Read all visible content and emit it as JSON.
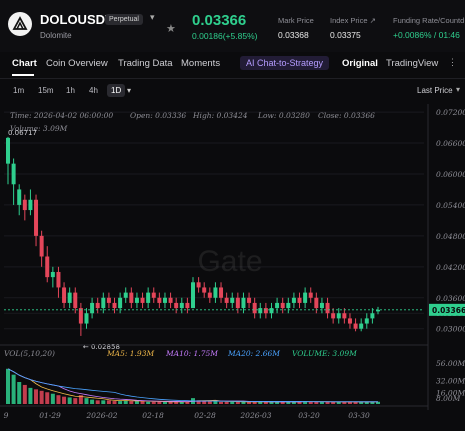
{
  "header": {
    "symbol": "DOLOUSDT",
    "badge": "Perpetual",
    "name": "Dolomite",
    "price": "0.03366",
    "change": "0.00186(+5.85%)",
    "mark_label": "Mark Price",
    "mark_value": "0.03368",
    "index_label": "Index Price ↗",
    "index_value": "0.03375",
    "funding_label": "Funding Rate/Countd",
    "funding_value": "+0.0086% / 01:46"
  },
  "tabs": [
    "Chart",
    "Coin Overview",
    "Trading Data",
    "Moments"
  ],
  "ai_button": "AI Chat-to-Strategy",
  "view_tabs": [
    "Original",
    "TradingView"
  ],
  "timeframes": [
    "1m",
    "15m",
    "1h",
    "4h",
    "1D"
  ],
  "last_price_dropdown": "Last Price",
  "ohlc": {
    "time": "Time: 2026-04-02 06:00:00",
    "open": "Open: 0.03336",
    "high": "High: 0.03424",
    "low": "Low: 0.03280",
    "close": "Close: 0.03366",
    "volume": "Volume: 3.09M"
  },
  "watermark": "Gate",
  "chart_data": {
    "type": "candlestick",
    "y_ticks": [
      "0.07200",
      "0.06600",
      "0.06000",
      "0.05400",
      "0.04800",
      "0.04200",
      "0.03600",
      "0.03300",
      "0.03000"
    ],
    "ylim": [
      0.0282,
      0.0724
    ],
    "current_price": 0.03366,
    "current_price_label": "0.03366",
    "high_marker": "0.06717",
    "low_marker": "0.02858",
    "x_ticks": [
      "9",
      "01-29",
      "2026-02",
      "02-18",
      "02-28",
      "2026-03",
      "03-20",
      "03-30"
    ],
    "candles": [
      [
        0.062,
        0.067,
        0.058,
        0.0672
      ],
      [
        0.058,
        0.062,
        0.054,
        0.063
      ],
      [
        0.054,
        0.057,
        0.052,
        0.058
      ],
      [
        0.055,
        0.053,
        0.051,
        0.056
      ],
      [
        0.053,
        0.055,
        0.052,
        0.057
      ],
      [
        0.055,
        0.048,
        0.046,
        0.056
      ],
      [
        0.048,
        0.044,
        0.042,
        0.049
      ],
      [
        0.044,
        0.04,
        0.039,
        0.046
      ],
      [
        0.04,
        0.041,
        0.038,
        0.042
      ],
      [
        0.041,
        0.038,
        0.036,
        0.042
      ],
      [
        0.038,
        0.035,
        0.034,
        0.039
      ],
      [
        0.035,
        0.037,
        0.034,
        0.038
      ],
      [
        0.037,
        0.034,
        0.033,
        0.038
      ],
      [
        0.034,
        0.031,
        0.0286,
        0.035
      ],
      [
        0.031,
        0.033,
        0.03,
        0.034
      ],
      [
        0.033,
        0.035,
        0.032,
        0.036
      ],
      [
        0.035,
        0.034,
        0.033,
        0.036
      ],
      [
        0.034,
        0.036,
        0.033,
        0.037
      ],
      [
        0.036,
        0.035,
        0.034,
        0.037
      ],
      [
        0.035,
        0.034,
        0.033,
        0.036
      ],
      [
        0.034,
        0.036,
        0.033,
        0.037
      ],
      [
        0.036,
        0.037,
        0.035,
        0.038
      ],
      [
        0.037,
        0.035,
        0.034,
        0.038
      ],
      [
        0.035,
        0.036,
        0.034,
        0.037
      ],
      [
        0.036,
        0.035,
        0.034,
        0.037
      ],
      [
        0.035,
        0.037,
        0.034,
        0.038
      ],
      [
        0.037,
        0.036,
        0.035,
        0.038
      ],
      [
        0.036,
        0.035,
        0.034,
        0.037
      ],
      [
        0.035,
        0.036,
        0.034,
        0.037
      ],
      [
        0.036,
        0.035,
        0.034,
        0.037
      ],
      [
        0.035,
        0.034,
        0.033,
        0.036
      ],
      [
        0.034,
        0.035,
        0.033,
        0.036
      ],
      [
        0.035,
        0.034,
        0.033,
        0.036
      ],
      [
        0.034,
        0.039,
        0.034,
        0.04
      ],
      [
        0.039,
        0.038,
        0.037,
        0.04
      ],
      [
        0.038,
        0.037,
        0.036,
        0.039
      ],
      [
        0.037,
        0.036,
        0.035,
        0.038
      ],
      [
        0.036,
        0.038,
        0.035,
        0.039
      ],
      [
        0.038,
        0.036,
        0.035,
        0.039
      ],
      [
        0.036,
        0.035,
        0.034,
        0.037
      ],
      [
        0.035,
        0.036,
        0.034,
        0.037
      ],
      [
        0.036,
        0.034,
        0.033,
        0.037
      ],
      [
        0.034,
        0.036,
        0.033,
        0.037
      ],
      [
        0.036,
        0.035,
        0.034,
        0.037
      ],
      [
        0.035,
        0.033,
        0.032,
        0.036
      ],
      [
        0.033,
        0.034,
        0.032,
        0.035
      ],
      [
        0.034,
        0.033,
        0.032,
        0.035
      ],
      [
        0.033,
        0.034,
        0.032,
        0.035
      ],
      [
        0.034,
        0.035,
        0.033,
        0.036
      ],
      [
        0.035,
        0.034,
        0.033,
        0.036
      ],
      [
        0.034,
        0.035,
        0.033,
        0.036
      ],
      [
        0.035,
        0.036,
        0.034,
        0.037
      ],
      [
        0.036,
        0.035,
        0.034,
        0.037
      ],
      [
        0.035,
        0.037,
        0.034,
        0.038
      ],
      [
        0.037,
        0.036,
        0.035,
        0.038
      ],
      [
        0.036,
        0.034,
        0.033,
        0.037
      ],
      [
        0.034,
        0.035,
        0.033,
        0.036
      ],
      [
        0.035,
        0.033,
        0.032,
        0.036
      ],
      [
        0.033,
        0.032,
        0.031,
        0.034
      ],
      [
        0.032,
        0.033,
        0.031,
        0.034
      ],
      [
        0.033,
        0.032,
        0.031,
        0.034
      ],
      [
        0.032,
        0.031,
        0.03,
        0.033
      ],
      [
        0.031,
        0.03,
        0.0295,
        0.032
      ],
      [
        0.03,
        0.031,
        0.0295,
        0.032
      ],
      [
        0.031,
        0.032,
        0.03,
        0.033
      ],
      [
        0.032,
        0.033,
        0.031,
        0.034
      ],
      [
        0.03336,
        0.03366,
        0.0328,
        0.03424
      ]
    ],
    "volume_panel": {
      "label": "VOL(5,10,20)",
      "ma5": "MA5: 1.93M",
      "ma10": "MA10: 1.75M",
      "ma20": "MA20: 2.66M",
      "volume": "VOLUME: 3.09M",
      "y_ticks": [
        "56.00M",
        "32.00M",
        "16.00M",
        "8.00M"
      ],
      "volumes_m": [
        48,
        40,
        30,
        26,
        22,
        20,
        18,
        16,
        14,
        12,
        10,
        9,
        8,
        12,
        8,
        6,
        5,
        5,
        5,
        4,
        4,
        5,
        4,
        4,
        4,
        3,
        3,
        3,
        3,
        3,
        3,
        3,
        3,
        8,
        5,
        4,
        4,
        4,
        3,
        3,
        3,
        3,
        3,
        3,
        3,
        3,
        3,
        3,
        3,
        3,
        3,
        3,
        3,
        4,
        3,
        3,
        3,
        3,
        3,
        3,
        3,
        3,
        3,
        3,
        3,
        3,
        3.09
      ]
    }
  },
  "colors": {
    "up": "#2fcf8e",
    "down": "#e4465a",
    "ai_text": "#b59cff",
    "ma5": "#f0b84a",
    "ma10": "#c77dff",
    "ma20": "#4aa3ff",
    "volume": "#2fcf8e"
  }
}
